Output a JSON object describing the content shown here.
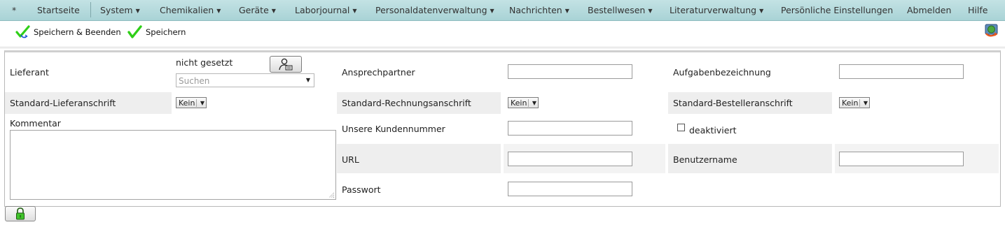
{
  "menu": {
    "star": "*",
    "items": [
      {
        "label": "Startseite",
        "dropdown": false
      },
      {
        "label": "System",
        "dropdown": true
      },
      {
        "label": "Chemikalien",
        "dropdown": true
      },
      {
        "label": "Geräte",
        "dropdown": true
      },
      {
        "label": "Laborjournal",
        "dropdown": true
      },
      {
        "label": "Personaldatenverwaltung",
        "dropdown": true
      },
      {
        "label": "Nachrichten",
        "dropdown": true
      },
      {
        "label": "Bestellwesen",
        "dropdown": true
      },
      {
        "label": "Literaturverwaltung",
        "dropdown": true
      },
      {
        "label": "Persönliche Einstellungen",
        "dropdown": false
      },
      {
        "label": "Abmelden",
        "dropdown": false
      },
      {
        "label": "Hilfe",
        "dropdown": false
      }
    ],
    "caret": "▼"
  },
  "toolbar": {
    "save_close_label": "Speichern & Beenden",
    "save_label": "Speichern"
  },
  "form": {
    "lieferant": {
      "label": "Lieferant",
      "value": "nicht gesetzt",
      "search_placeholder": "Suchen"
    },
    "ansprechpartner": {
      "label": "Ansprechpartner",
      "value": ""
    },
    "aufgabenbezeichnung": {
      "label": "Aufgabenbezeichnung",
      "value": ""
    },
    "standard_lieferanschrift": {
      "label": "Standard-Lieferanschrift",
      "value": "Kein"
    },
    "standard_rechnungsanschrift": {
      "label": "Standard-Rechnungsanschrift",
      "value": "Kein"
    },
    "standard_bestelleranschrift": {
      "label": "Standard-Bestelleranschrift",
      "value": "Kein"
    },
    "kommentar": {
      "label": "Kommentar",
      "value": ""
    },
    "kundennummer": {
      "label": "Unsere Kundennummer",
      "value": ""
    },
    "deaktiviert": {
      "label": "deaktiviert",
      "checked": false
    },
    "url": {
      "label": "URL",
      "value": ""
    },
    "benutzername": {
      "label": "Benutzername",
      "value": ""
    },
    "passwort": {
      "label": "Passwort",
      "value": ""
    }
  },
  "colors": {
    "menu_bg": "#b6dadd",
    "check_green": "#2fcf18",
    "row_alt": "#eeeeee"
  }
}
